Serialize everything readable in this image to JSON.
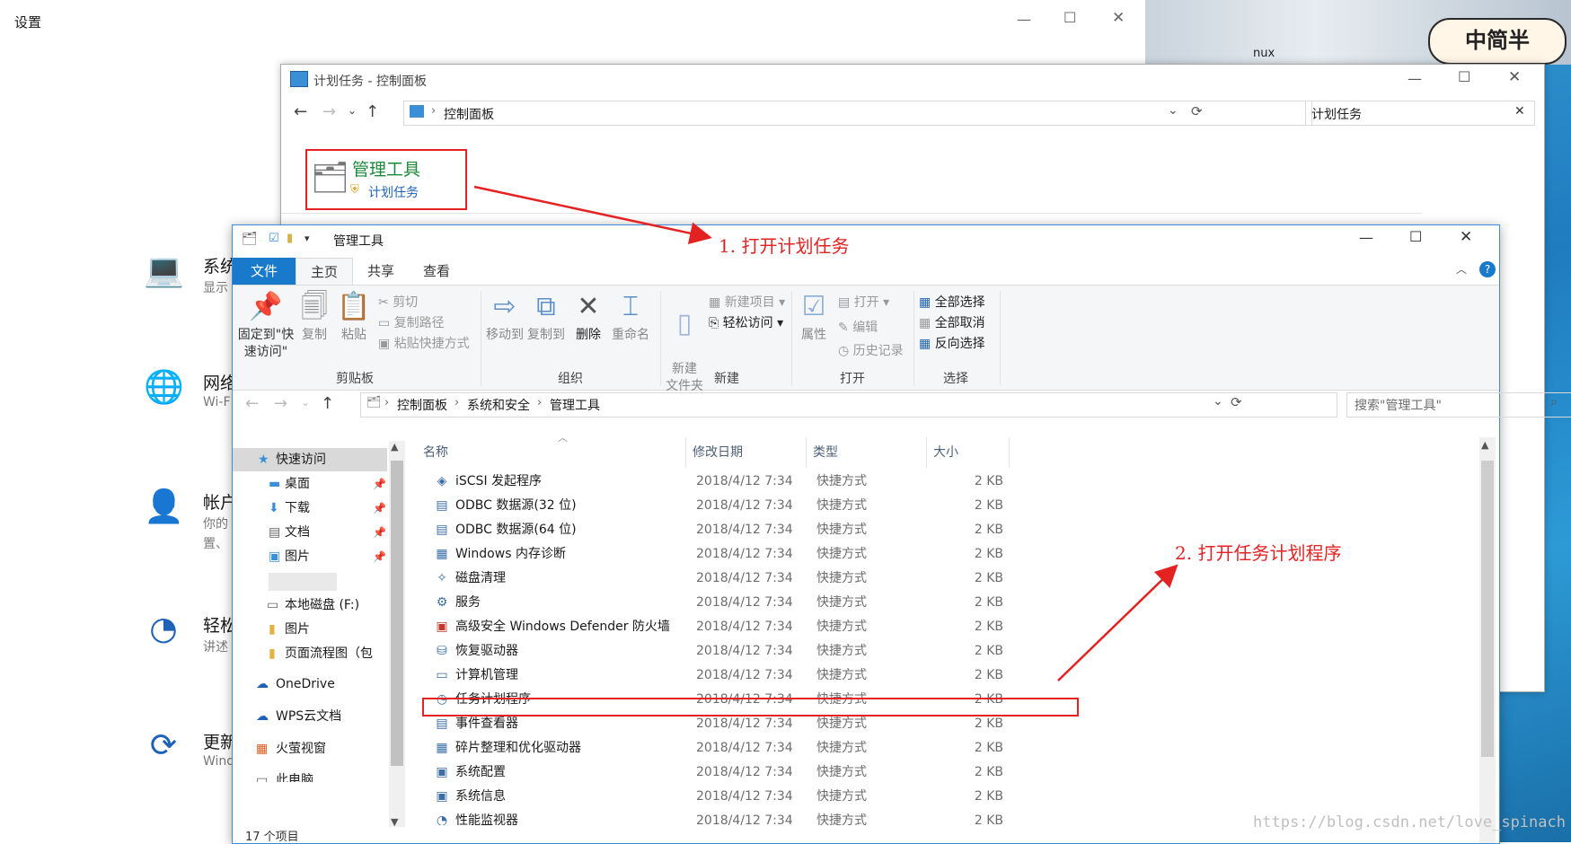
{
  "settings": {
    "title": "设置",
    "items": [
      {
        "icon": "laptop-icon",
        "title": "系统",
        "sub": "显示"
      },
      {
        "icon": "globe-icon",
        "title": "网络",
        "sub": "Wi-F"
      },
      {
        "icon": "person-icon",
        "title": "帐户",
        "sub": "你的",
        "sub2": "置、"
      },
      {
        "icon": "accessibility-icon",
        "title": "轻松",
        "sub": "讲述"
      },
      {
        "icon": "refresh-icon",
        "title": "更新",
        "sub": "Wind"
      }
    ]
  },
  "control_panel": {
    "title": "计划任务 - 控制面板",
    "breadcrumb": "控制面板",
    "search_value": "计划任务",
    "result_title": "管理工具",
    "result_link": "计划任务"
  },
  "explorer": {
    "title": "管理工具",
    "tabs": [
      "文件",
      "主页",
      "共享",
      "查看"
    ],
    "ribbon": {
      "pin": "固定到\"快速访问\"",
      "copy": "复制",
      "paste": "粘贴",
      "cut": "剪切",
      "copy_path": "复制路径",
      "paste_shortcut": "粘贴快捷方式",
      "clipboard": "剪贴板",
      "move_to": "移动到",
      "copy_to": "复制到",
      "delete": "删除",
      "rename": "重命名",
      "organize": "组织",
      "new_item": "新建项目",
      "easy_access": "轻松访问",
      "new_folder": "新建\n文件夹",
      "new": "新建",
      "properties": "属性",
      "open_small": "打开",
      "edit": "编辑",
      "history": "历史记录",
      "open": "打开",
      "select_all": "全部选择",
      "select_none": "全部取消",
      "invert": "反向选择",
      "select": "选择"
    },
    "breadcrumb": [
      "控制面板",
      "系统和安全",
      "管理工具"
    ],
    "search_placeholder": "搜索\"管理工具\"",
    "nav": [
      {
        "label": "快速访问",
        "icon": "star-icon",
        "indent": 0,
        "pin": false
      },
      {
        "label": "桌面",
        "icon": "folder-icon",
        "indent": 1,
        "pin": true
      },
      {
        "label": "下载",
        "icon": "download-folder-icon",
        "indent": 1,
        "pin": true
      },
      {
        "label": "文档",
        "icon": "document-folder-icon",
        "indent": 1,
        "pin": true
      },
      {
        "label": "图片",
        "icon": "pictures-folder-icon",
        "indent": 1,
        "pin": true
      },
      {
        "label": "",
        "icon": "blurred-folder-icon",
        "indent": 1,
        "pin": false
      },
      {
        "label": "本地磁盘 (F:)",
        "icon": "drive-icon",
        "indent": 1,
        "pin": false
      },
      {
        "label": "图片",
        "icon": "folder-icon",
        "indent": 1,
        "pin": false
      },
      {
        "label": "页面流程图（包",
        "icon": "folder-icon",
        "indent": 1,
        "pin": false
      },
      {
        "label": "OneDrive",
        "icon": "cloud-icon",
        "indent": 0,
        "pin": false
      },
      {
        "label": "WPS云文档",
        "icon": "wps-cloud-icon",
        "indent": 0,
        "pin": false
      },
      {
        "label": "火萤视窗",
        "icon": "windows-logo-icon",
        "indent": 0,
        "pin": false
      },
      {
        "label": "此电脑",
        "icon": "computer-icon",
        "indent": 0,
        "pin": false
      }
    ],
    "columns": [
      "名称",
      "修改日期",
      "类型",
      "大小"
    ],
    "files": [
      {
        "name": "iSCSI 发起程序",
        "date": "2018/4/12 7:34",
        "type": "快捷方式",
        "size": "2 KB"
      },
      {
        "name": "ODBC 数据源(32 位)",
        "date": "2018/4/12 7:34",
        "type": "快捷方式",
        "size": "2 KB"
      },
      {
        "name": "ODBC 数据源(64 位)",
        "date": "2018/4/12 7:34",
        "type": "快捷方式",
        "size": "2 KB"
      },
      {
        "name": "Windows 内存诊断",
        "date": "2018/4/12 7:34",
        "type": "快捷方式",
        "size": "2 KB"
      },
      {
        "name": "磁盘清理",
        "date": "2018/4/12 7:34",
        "type": "快捷方式",
        "size": "2 KB"
      },
      {
        "name": "服务",
        "date": "2018/4/12 7:34",
        "type": "快捷方式",
        "size": "2 KB"
      },
      {
        "name": "高级安全 Windows Defender 防火墙",
        "date": "2018/4/12 7:34",
        "type": "快捷方式",
        "size": "2 KB"
      },
      {
        "name": "恢复驱动器",
        "date": "2018/4/12 7:34",
        "type": "快捷方式",
        "size": "2 KB"
      },
      {
        "name": "计算机管理",
        "date": "2018/4/12 7:34",
        "type": "快捷方式",
        "size": "2 KB"
      },
      {
        "name": "任务计划程序",
        "date": "2018/4/12 7:34",
        "type": "快捷方式",
        "size": "2 KB"
      },
      {
        "name": "事件查看器",
        "date": "2018/4/12 7:34",
        "type": "快捷方式",
        "size": "2 KB"
      },
      {
        "name": "碎片整理和优化驱动器",
        "date": "2018/4/12 7:34",
        "type": "快捷方式",
        "size": "2 KB"
      },
      {
        "name": "系统配置",
        "date": "2018/4/12 7:34",
        "type": "快捷方式",
        "size": "2 KB"
      },
      {
        "name": "系统信息",
        "date": "2018/4/12 7:34",
        "type": "快捷方式",
        "size": "2 KB"
      },
      {
        "name": "性能监视器",
        "date": "2018/4/12 7:34",
        "type": "快捷方式",
        "size": "2 KB"
      }
    ],
    "status": "17 个项目"
  },
  "annotations": {
    "step1": "1. 打开计划任务",
    "step2": "2. 打开任务计划程序"
  },
  "watermark": "https://blog.csdn.net/love_spinach",
  "sticker": "中简半",
  "desktop_label": "nux",
  "colors": {
    "accent": "#1979ca",
    "annotation": "#e52222",
    "link": "#1e62b8"
  }
}
